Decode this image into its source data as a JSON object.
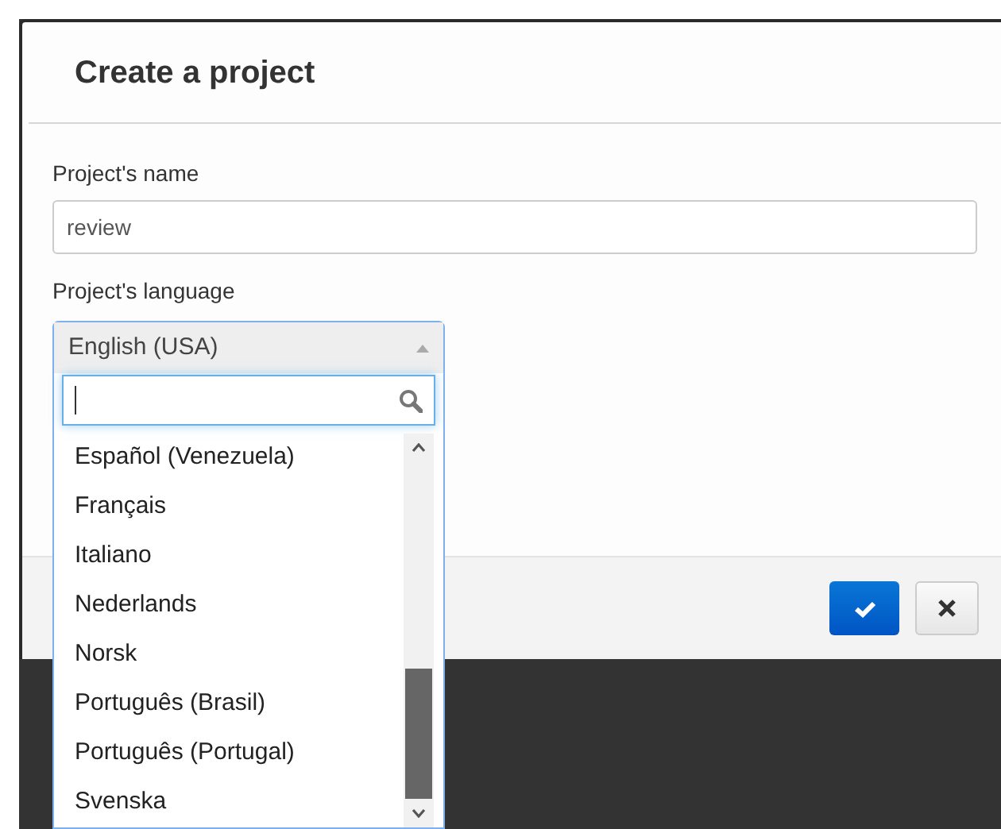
{
  "dialog": {
    "title": "Create a project"
  },
  "name_field": {
    "label": "Project's name",
    "value": "review"
  },
  "language_field": {
    "label": "Project's language",
    "value": "English (USA)",
    "expanded": true
  },
  "language_options": [
    {
      "label": "Español (Venezuela)"
    },
    {
      "label": "Français"
    },
    {
      "label": "Italiano"
    },
    {
      "label": "Nederlands"
    },
    {
      "label": "Norsk"
    },
    {
      "label": "Português (Brasil)"
    },
    {
      "label": "Português (Portugal)"
    },
    {
      "label": "Svenska"
    }
  ],
  "footer_buttons": [
    {
      "kind": "confirm"
    },
    {
      "kind": "cancel"
    }
  ]
}
